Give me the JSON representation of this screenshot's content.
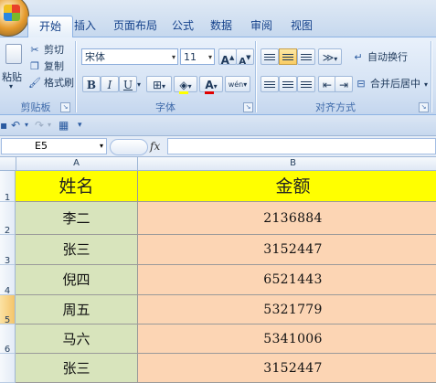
{
  "tabs": [
    {
      "label": "开始",
      "active": true
    },
    {
      "label": "插入",
      "active": false
    },
    {
      "label": "页面布局",
      "active": false
    },
    {
      "label": "公式",
      "active": false
    },
    {
      "label": "数据",
      "active": false
    },
    {
      "label": "审阅",
      "active": false
    },
    {
      "label": "视图",
      "active": false
    }
  ],
  "ribbon": {
    "clipboard": {
      "paste_label": "粘贴",
      "cut_label": "剪切",
      "copy_label": "复制",
      "format_painter_label": "格式刷",
      "group_label": "剪贴板"
    },
    "font": {
      "font_name": "宋体",
      "font_size": "11",
      "grow_label": "A",
      "shrink_label": "A",
      "bold_label": "B",
      "italic_label": "I",
      "underline_label": "U",
      "font_color_label": "A",
      "phonetic_label": "wén",
      "group_label": "字体"
    },
    "alignment": {
      "wrap_text_label": "自动换行",
      "merge_center_label": "合并后居中",
      "group_label": "对齐方式"
    }
  },
  "formula_bar": {
    "name_box": "E5",
    "fx_label": "fx",
    "formula": ""
  },
  "sheet": {
    "columns": [
      "A",
      "B"
    ],
    "header_row": {
      "row": "1",
      "name": "姓名",
      "amount": "金额"
    },
    "rows": [
      {
        "row": "2",
        "name": "李二",
        "amount": "2136884"
      },
      {
        "row": "3",
        "name": "张三",
        "amount": "3152447"
      },
      {
        "row": "4",
        "name": "倪四",
        "amount": "6521443"
      },
      {
        "row": "5",
        "name": "周五",
        "amount": "5321779"
      },
      {
        "row": "6",
        "name": "马六",
        "amount": "5341006"
      },
      {
        "row": "7",
        "name": "张三",
        "amount": "3152447"
      }
    ],
    "active_row": "5",
    "colors": {
      "header_fill": "#ffff00",
      "name_fill": "#d8e4bc",
      "amount_fill": "#fcd5b4",
      "active_header": "#f4c46a"
    }
  }
}
